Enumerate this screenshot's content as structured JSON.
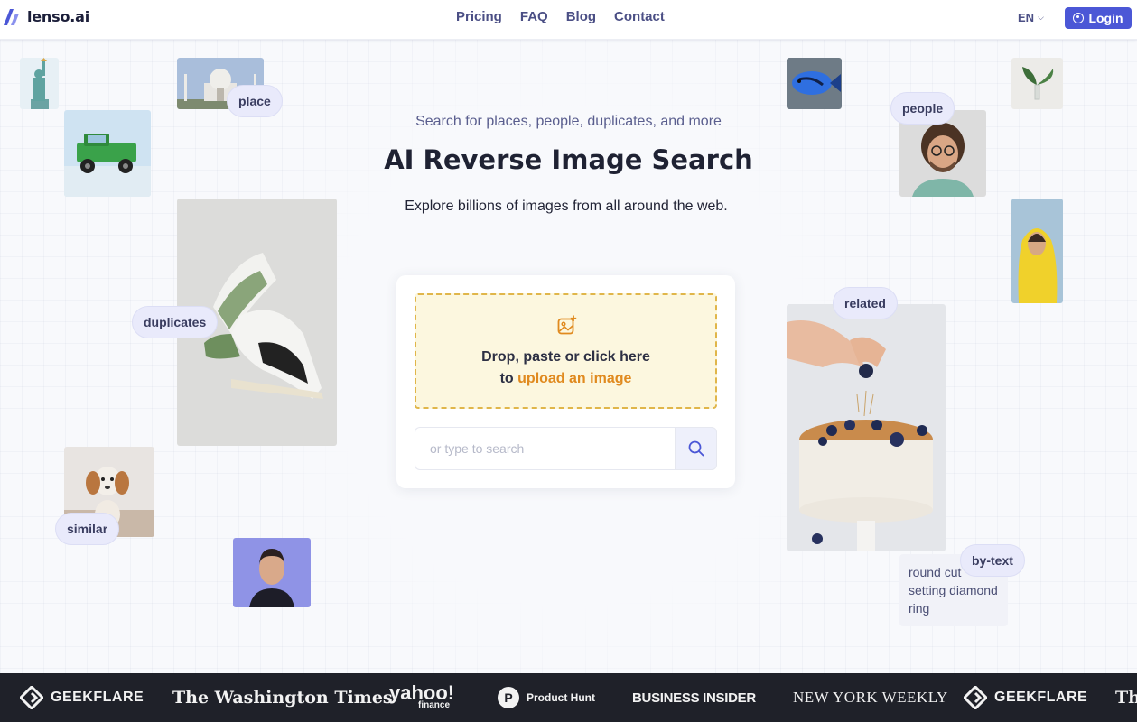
{
  "header": {
    "brand": "lenso.ai",
    "nav": [
      "Pricing",
      "FAQ",
      "Blog",
      "Contact"
    ],
    "language": "EN",
    "login_label": "Login"
  },
  "hero": {
    "subtitle": "Search for places, people, duplicates, and more",
    "title": "AI Reverse Image Search",
    "description": "Explore billions of images from all around the web."
  },
  "upload": {
    "line1": "Drop, paste or click here",
    "line2_prefix": "to ",
    "line2_link": "upload an image",
    "search_placeholder": "or type to search"
  },
  "tags": {
    "place": "place",
    "duplicates": "duplicates",
    "similar": "similar",
    "people": "people",
    "related": "related",
    "by_text": "by-text"
  },
  "by_text_sample": "round cut setting diamond ring",
  "press": [
    "GEEKFLARE",
    "The Washington Times",
    "yahoo!",
    "finance",
    "Product Hunt",
    "BUSINESS INSIDER",
    "NEW YORK WEEKLY",
    "GEEKFLARE",
    "Th"
  ],
  "colors": {
    "brand": "#4b57d6",
    "accent_orange": "#e08a1f",
    "nav_text": "#4b4f85",
    "dropzone_bg": "#fcf7df",
    "press_bg": "#1f2129"
  }
}
